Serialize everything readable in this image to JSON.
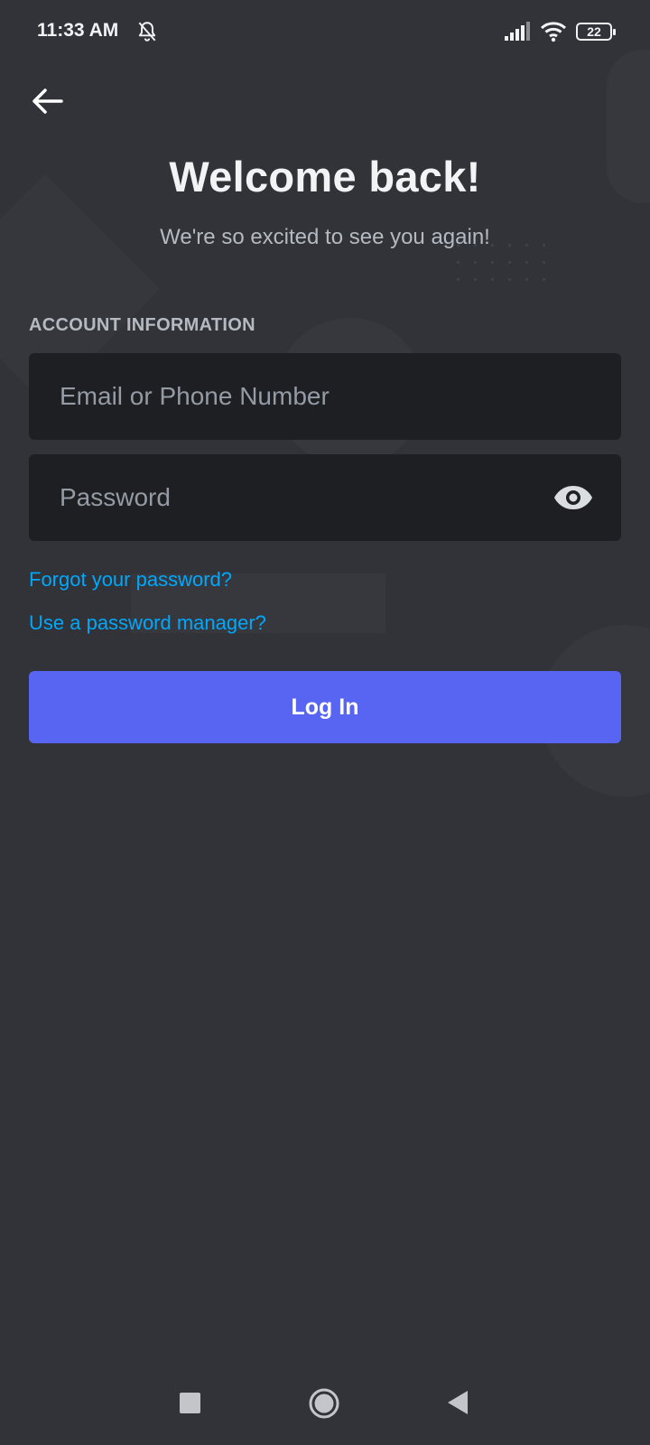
{
  "status_bar": {
    "time": "11:33 AM",
    "battery": "22",
    "icons": [
      "mute-bell-icon",
      "signal-icon",
      "wifi-icon",
      "battery-icon"
    ]
  },
  "header": {
    "back_icon": "arrow-left-icon",
    "title": "Welcome back!",
    "subtitle": "We're so excited to see you again!"
  },
  "form": {
    "section_label": "ACCOUNT INFORMATION",
    "email": {
      "value": "",
      "placeholder": "Email or Phone Number"
    },
    "password": {
      "value": "",
      "placeholder": "Password",
      "toggle_icon": "eye-icon"
    },
    "forgot_link": "Forgot your password?",
    "manager_link": "Use a password manager?",
    "login_label": "Log In"
  },
  "nav_bar": {
    "icons": [
      "recents-square-icon",
      "home-circle-icon",
      "back-triangle-icon"
    ]
  },
  "colors": {
    "background": "#313338",
    "field": "#1e1f22",
    "accent": "#5865f2",
    "link": "#00a8fc",
    "muted_text": "#b5bac1"
  }
}
